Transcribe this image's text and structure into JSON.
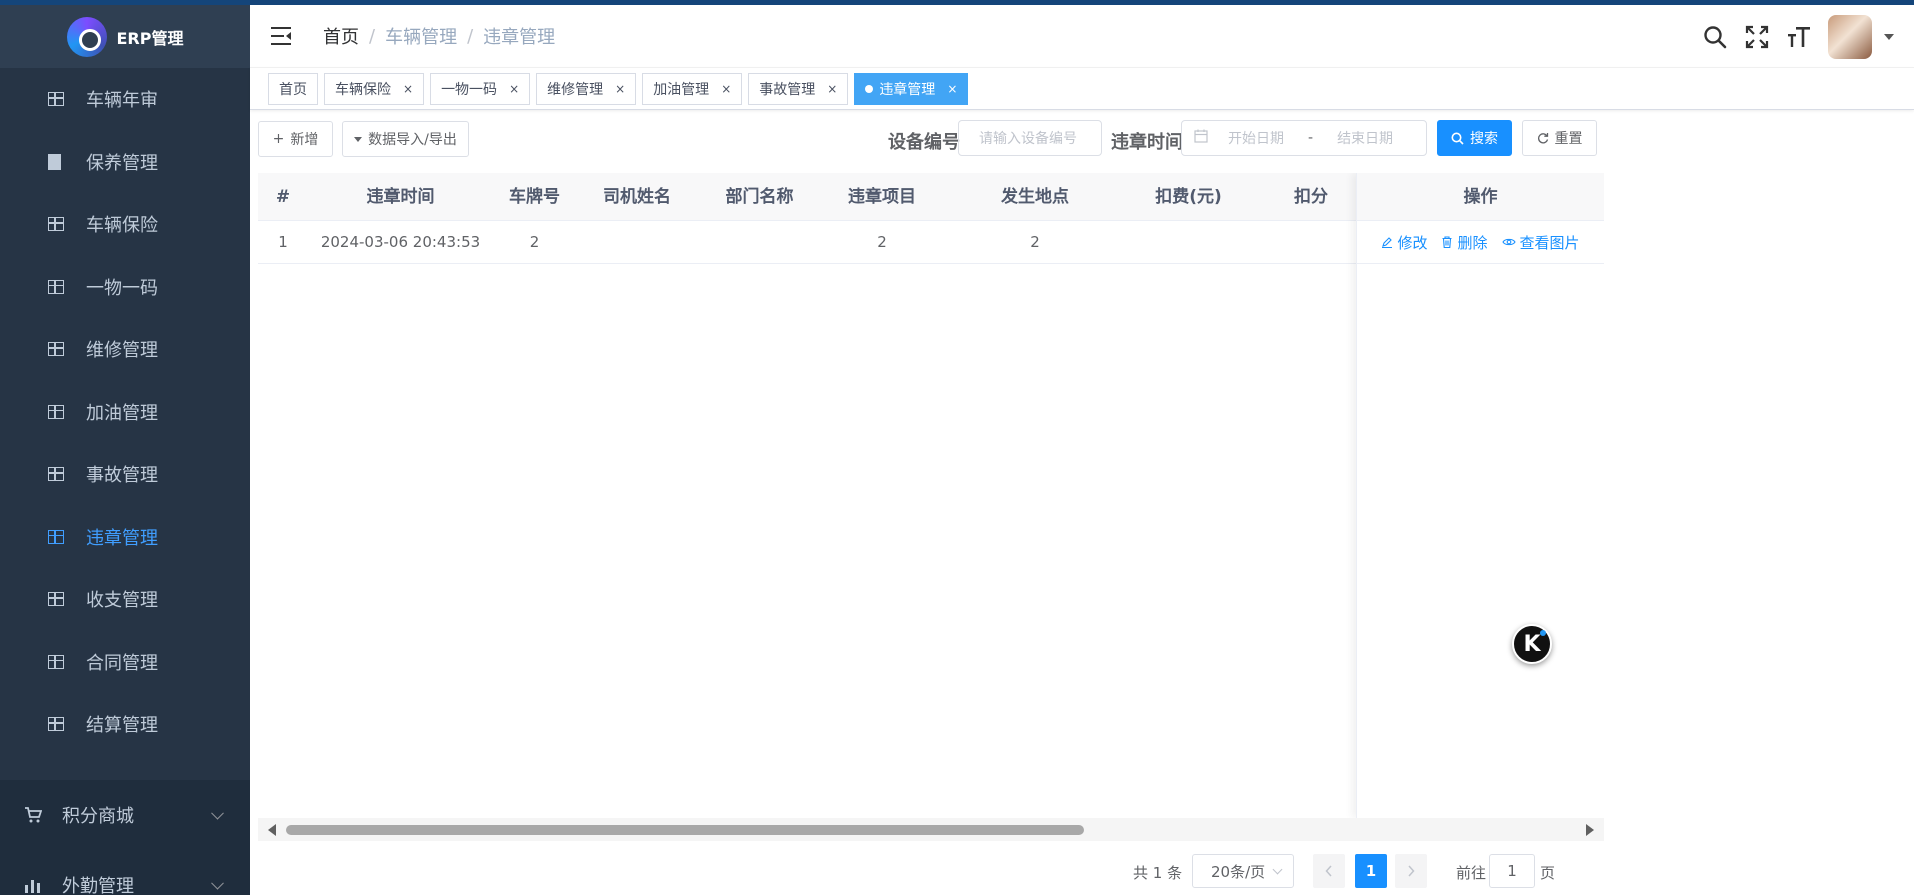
{
  "app": {
    "title": "ERP管理"
  },
  "sidebar": {
    "items": [
      {
        "label": "车辆年审",
        "icon": "table-icon",
        "active": false
      },
      {
        "label": "保养管理",
        "icon": "document-icon",
        "active": false
      },
      {
        "label": "车辆保险",
        "icon": "table-icon",
        "active": false
      },
      {
        "label": "一物一码",
        "icon": "table-icon",
        "active": false
      },
      {
        "label": "维修管理",
        "icon": "table-icon",
        "active": false
      },
      {
        "label": "加油管理",
        "icon": "table-icon",
        "active": false
      },
      {
        "label": "事故管理",
        "icon": "table-icon",
        "active": false
      },
      {
        "label": "违章管理",
        "icon": "table-icon",
        "active": true
      },
      {
        "label": "收支管理",
        "icon": "table-icon",
        "active": false
      },
      {
        "label": "合同管理",
        "icon": "table-icon",
        "active": false
      },
      {
        "label": "结算管理",
        "icon": "table-icon",
        "active": false
      }
    ],
    "submenus": [
      {
        "label": "积分商城",
        "icon": "cart-icon"
      },
      {
        "label": "外勤管理",
        "icon": "bar-chart-icon"
      }
    ],
    "active_color": "#409eff"
  },
  "breadcrumb": {
    "items": [
      "首页",
      "车辆管理",
      "违章管理"
    ],
    "separator": "/"
  },
  "tags": [
    {
      "label": "首页",
      "closable": false,
      "active": false
    },
    {
      "label": "车辆保险",
      "closable": true,
      "active": false
    },
    {
      "label": "一物一码",
      "closable": true,
      "active": false
    },
    {
      "label": "维修管理",
      "closable": true,
      "active": false
    },
    {
      "label": "加油管理",
      "closable": true,
      "active": false
    },
    {
      "label": "事故管理",
      "closable": true,
      "active": false
    },
    {
      "label": "违章管理",
      "closable": true,
      "active": true
    }
  ],
  "tag_close_glyph": "×",
  "toolbar": {
    "add_label": "新增",
    "import_export_label": "数据导入/导出",
    "device_label": "设备编号",
    "device_placeholder": "请输入设备编号",
    "time_label": "违章时间",
    "start_placeholder": "开始日期",
    "range_sep": "-",
    "end_placeholder": "结束日期",
    "search_label": "搜索",
    "reset_label": "重置"
  },
  "table": {
    "columns": [
      "#",
      "违章时间",
      "车牌号",
      "司机姓名",
      "部门名称",
      "违章项目",
      "发生地点",
      "扣费(元)",
      "扣分"
    ],
    "ops_header": "操作",
    "rows": [
      {
        "cells": [
          "1",
          "2024-03-06 20:43:53",
          "2",
          "",
          "",
          "2",
          "2",
          "",
          ""
        ]
      }
    ],
    "ops": {
      "edit": "修改",
      "delete": "删除",
      "view": "查看图片"
    }
  },
  "pagination": {
    "total_text": "共 1 条",
    "page_size": "20条/页",
    "current": "1",
    "goto_label": "前往",
    "goto_value": "1",
    "page_suffix": "页"
  },
  "float_button": {
    "label": "K"
  }
}
